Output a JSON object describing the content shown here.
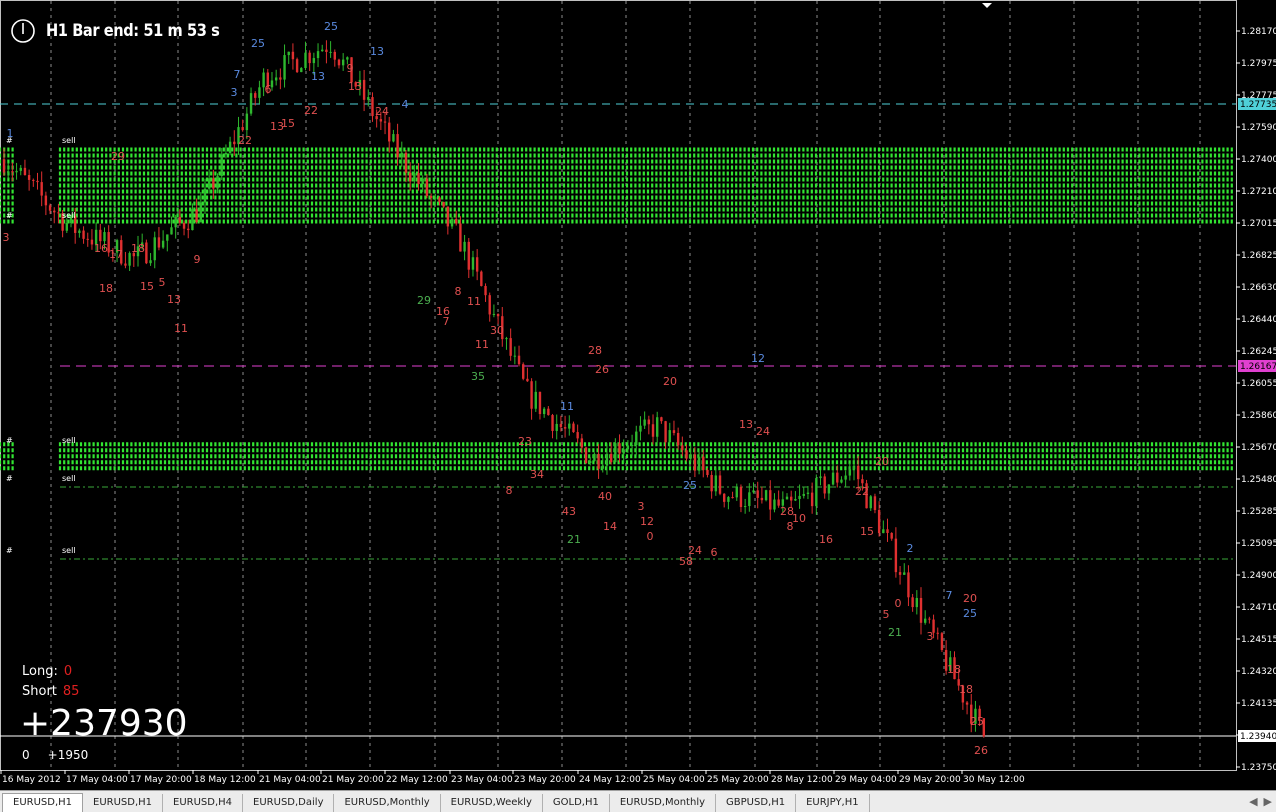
{
  "timer": {
    "text": "H1 Bar end: 51 m 53 s",
    "icon": "clock-icon"
  },
  "stats": {
    "long_label": "Long:",
    "long_value": "0",
    "short_label": "Short",
    "short_value": "85",
    "profit": "+237930",
    "small_left": "0",
    "small_right": "+1950"
  },
  "colors": {
    "bull": "#2eb82e",
    "bear": "#e03030",
    "zone": "#32e632",
    "grid": "#ffffff",
    "upper_line": "#4fd0d8",
    "mid_line": "#e040d0",
    "lower_line": "#3aa83a",
    "current_line": "#ffffff",
    "count_red": "#e05050",
    "count_blue": "#5a8adf",
    "count_green": "#4caf50"
  },
  "price_axis": {
    "ticks": [
      "1.28170",
      "1.27975",
      "1.27775",
      "1.27590",
      "1.27400",
      "1.27210",
      "1.27015",
      "1.26825",
      "1.26630",
      "1.26440",
      "1.26245",
      "1.26055",
      "1.25860",
      "1.25670",
      "1.25480",
      "1.25285",
      "1.25095",
      "1.24900",
      "1.24710",
      "1.24515",
      "1.24320",
      "1.24135",
      "1.23940",
      "1.23750"
    ],
    "markers": [
      {
        "value": "1.27735",
        "color": "#4fd0d8"
      },
      {
        "value": "1.26167",
        "color": "#e040d0"
      },
      {
        "value": "1.23940",
        "color": "#ffffff"
      }
    ]
  },
  "time_axis": [
    "16 May 2012",
    "17 May 04:00",
    "17 May 20:00",
    "18 May 12:00",
    "21 May 04:00",
    "21 May 20:00",
    "22 May 12:00",
    "23 May 04:00",
    "23 May 20:00",
    "24 May 12:00",
    "25 May 04:00",
    "25 May 20:00",
    "28 May 12:00",
    "29 May 04:00",
    "29 May 20:00",
    "30 May 12:00"
  ],
  "zone_labels": {
    "hash": "#",
    "sell": "sell"
  },
  "chart_data": {
    "type": "line",
    "title": "EURUSD,H1",
    "ylim": [
      1.2375,
      1.2827
    ],
    "x": [
      "16 May 2012",
      "17 May 04:00",
      "17 May 20:00",
      "18 May 12:00",
      "21 May 04:00",
      "21 May 20:00",
      "22 May 12:00",
      "23 May 04:00",
      "23 May 20:00",
      "24 May 12:00",
      "25 May 04:00",
      "25 May 20:00",
      "28 May 12:00",
      "29 May 04:00",
      "29 May 20:00",
      "30 May 12:00"
    ],
    "series": [
      {
        "values": [
          1.274,
          1.27,
          1.268,
          1.271,
          1.279,
          1.281,
          1.2745,
          1.269,
          1.26,
          1.256,
          1.258,
          1.254,
          1.253,
          1.2555,
          1.247,
          1.2394
        ]
      }
    ],
    "supply_zones": [
      {
        "low": 1.2701,
        "high": 1.2747
      },
      {
        "low": 1.2553,
        "high": 1.257
      }
    ],
    "levels": [
      1.27735,
      1.26167,
      1.2545,
      1.2502,
      1.2394
    ],
    "counts": [
      {
        "t": "3",
        "x": 6,
        "y": 241,
        "c": "r"
      },
      {
        "t": "1",
        "x": 10,
        "y": 137,
        "c": "b"
      },
      {
        "t": "29",
        "x": 118,
        "y": 160,
        "c": "r"
      },
      {
        "t": "18",
        "x": 106,
        "y": 292,
        "c": "r"
      },
      {
        "t": "17",
        "x": 116,
        "y": 258,
        "c": "r"
      },
      {
        "t": "16",
        "x": 101,
        "y": 252,
        "c": "r"
      },
      {
        "t": "15",
        "x": 147,
        "y": 290,
        "c": "r"
      },
      {
        "t": "5",
        "x": 162,
        "y": 286,
        "c": "r"
      },
      {
        "t": "13",
        "x": 174,
        "y": 303,
        "c": "r"
      },
      {
        "t": "11",
        "x": 181,
        "y": 332,
        "c": "r"
      },
      {
        "t": "18",
        "x": 138,
        "y": 252,
        "c": "r"
      },
      {
        "t": "9",
        "x": 197,
        "y": 263,
        "c": "r"
      },
      {
        "t": "7",
        "x": 237,
        "y": 78,
        "c": "b"
      },
      {
        "t": "25",
        "x": 258,
        "y": 47,
        "c": "b"
      },
      {
        "t": "6",
        "x": 268,
        "y": 93,
        "c": "r"
      },
      {
        "t": "22",
        "x": 245,
        "y": 144,
        "c": "r"
      },
      {
        "t": "3",
        "x": 234,
        "y": 96,
        "c": "b"
      },
      {
        "t": "13",
        "x": 277,
        "y": 130,
        "c": "r"
      },
      {
        "t": "15",
        "x": 288,
        "y": 127,
        "c": "r"
      },
      {
        "t": "25",
        "x": 331,
        "y": 30,
        "c": "b"
      },
      {
        "t": "13",
        "x": 318,
        "y": 80,
        "c": "b"
      },
      {
        "t": "22",
        "x": 311,
        "y": 114,
        "c": "r"
      },
      {
        "t": "9",
        "x": 350,
        "y": 72,
        "c": "r"
      },
      {
        "t": "13",
        "x": 355,
        "y": 90,
        "c": "r"
      },
      {
        "t": "13",
        "x": 377,
        "y": 55,
        "c": "b"
      },
      {
        "t": "24",
        "x": 382,
        "y": 115,
        "c": "r"
      },
      {
        "t": "4",
        "x": 405,
        "y": 108,
        "c": "b"
      },
      {
        "t": "29",
        "x": 424,
        "y": 304,
        "c": "g"
      },
      {
        "t": "16",
        "x": 443,
        "y": 315,
        "c": "r"
      },
      {
        "t": "7",
        "x": 446,
        "y": 325,
        "c": "r"
      },
      {
        "t": "8",
        "x": 458,
        "y": 295,
        "c": "r"
      },
      {
        "t": "11",
        "x": 474,
        "y": 305,
        "c": "r"
      },
      {
        "t": "30",
        "x": 497,
        "y": 334,
        "c": "r"
      },
      {
        "t": "11",
        "x": 482,
        "y": 348,
        "c": "r"
      },
      {
        "t": "35",
        "x": 478,
        "y": 380,
        "c": "g"
      },
      {
        "t": "8",
        "x": 509,
        "y": 494,
        "c": "r"
      },
      {
        "t": "23",
        "x": 525,
        "y": 445,
        "c": "r"
      },
      {
        "t": "34",
        "x": 537,
        "y": 478,
        "c": "r"
      },
      {
        "t": "28",
        "x": 595,
        "y": 354,
        "c": "r"
      },
      {
        "t": "26",
        "x": 602,
        "y": 373,
        "c": "r"
      },
      {
        "t": "11",
        "x": 567,
        "y": 410,
        "c": "b"
      },
      {
        "t": "43",
        "x": 569,
        "y": 515,
        "c": "r"
      },
      {
        "t": "21",
        "x": 574,
        "y": 543,
        "c": "g"
      },
      {
        "t": "40",
        "x": 605,
        "y": 500,
        "c": "r"
      },
      {
        "t": "14",
        "x": 610,
        "y": 530,
        "c": "r"
      },
      {
        "t": "3",
        "x": 641,
        "y": 510,
        "c": "r"
      },
      {
        "t": "12",
        "x": 647,
        "y": 525,
        "c": "r"
      },
      {
        "t": "0",
        "x": 650,
        "y": 540,
        "c": "r"
      },
      {
        "t": "20",
        "x": 670,
        "y": 385,
        "c": "r"
      },
      {
        "t": "25",
        "x": 690,
        "y": 489,
        "c": "b"
      },
      {
        "t": "58",
        "x": 686,
        "y": 565,
        "c": "r"
      },
      {
        "t": "24",
        "x": 695,
        "y": 554,
        "c": "r"
      },
      {
        "t": "6",
        "x": 714,
        "y": 556,
        "c": "r"
      },
      {
        "t": "12",
        "x": 758,
        "y": 362,
        "c": "b"
      },
      {
        "t": "13",
        "x": 746,
        "y": 428,
        "c": "r"
      },
      {
        "t": "24",
        "x": 763,
        "y": 435,
        "c": "r"
      },
      {
        "t": "28",
        "x": 787,
        "y": 515,
        "c": "r"
      },
      {
        "t": "8",
        "x": 790,
        "y": 530,
        "c": "r"
      },
      {
        "t": "10",
        "x": 799,
        "y": 522,
        "c": "r"
      },
      {
        "t": "16",
        "x": 826,
        "y": 543,
        "c": "r"
      },
      {
        "t": "22",
        "x": 862,
        "y": 495,
        "c": "r"
      },
      {
        "t": "20",
        "x": 882,
        "y": 465,
        "c": "r"
      },
      {
        "t": "15",
        "x": 867,
        "y": 535,
        "c": "r"
      },
      {
        "t": "2",
        "x": 910,
        "y": 552,
        "c": "b"
      },
      {
        "t": "5",
        "x": 886,
        "y": 618,
        "c": "r"
      },
      {
        "t": "0",
        "x": 898,
        "y": 607,
        "c": "r"
      },
      {
        "t": "21",
        "x": 895,
        "y": 636,
        "c": "g"
      },
      {
        "t": "20",
        "x": 970,
        "y": 602,
        "c": "r"
      },
      {
        "t": "7",
        "x": 949,
        "y": 599,
        "c": "b"
      },
      {
        "t": "25",
        "x": 970,
        "y": 617,
        "c": "b"
      },
      {
        "t": "3",
        "x": 930,
        "y": 640,
        "c": "r"
      },
      {
        "t": "18",
        "x": 954,
        "y": 673,
        "c": "r"
      },
      {
        "t": "18",
        "x": 966,
        "y": 693,
        "c": "r"
      },
      {
        "t": "25",
        "x": 977,
        "y": 725,
        "c": "r"
      },
      {
        "t": "26",
        "x": 981,
        "y": 754,
        "c": "r"
      }
    ]
  },
  "tabs": [
    "EURUSD,H1",
    "EURUSD,H1",
    "EURUSD,H4",
    "EURUSD,Daily",
    "EURUSD,Monthly",
    "EURUSD,Weekly",
    "GOLD,H1",
    "EURUSD,Monthly",
    "GBPUSD,H1",
    "EURJPY,H1"
  ],
  "tab_scroll": {
    "left": "◀",
    "right": "▶"
  }
}
